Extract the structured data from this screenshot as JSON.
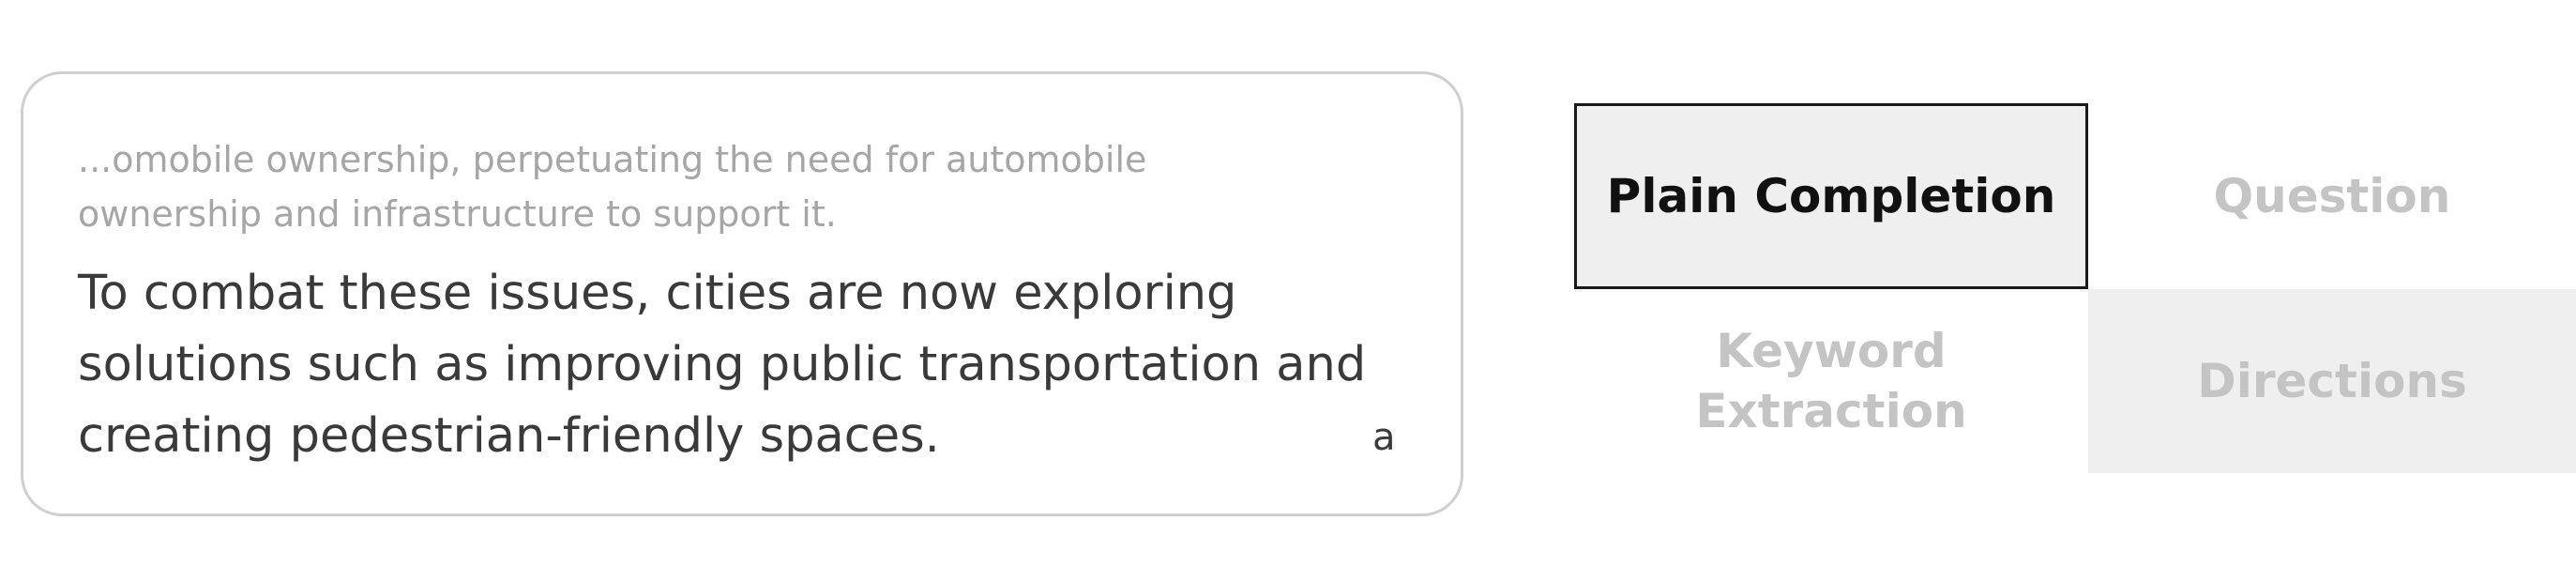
{
  "completion": {
    "context": "...omobile ownership, perpetuating the need for automobile ownership and infrastructure to support it.",
    "generated": "To combat these issues, cities are now exploring solutions such as improving public transportation and creating pedestrian-friendly spaces.",
    "shortcut_key": "a"
  },
  "modes": {
    "selected": "Plain Completion",
    "plain_completion": "Plain Completion",
    "question": "Question",
    "keyword_extraction": "Keyword Extraction",
    "directions": "Directions"
  },
  "colors": {
    "selected_text": "#111111",
    "unselected_text": "#c4c4c4",
    "selected_fill": "#efefef",
    "context_text": "#a6a6a6",
    "body_text": "#3a3a3a",
    "card_border": "#cfcfcf"
  }
}
